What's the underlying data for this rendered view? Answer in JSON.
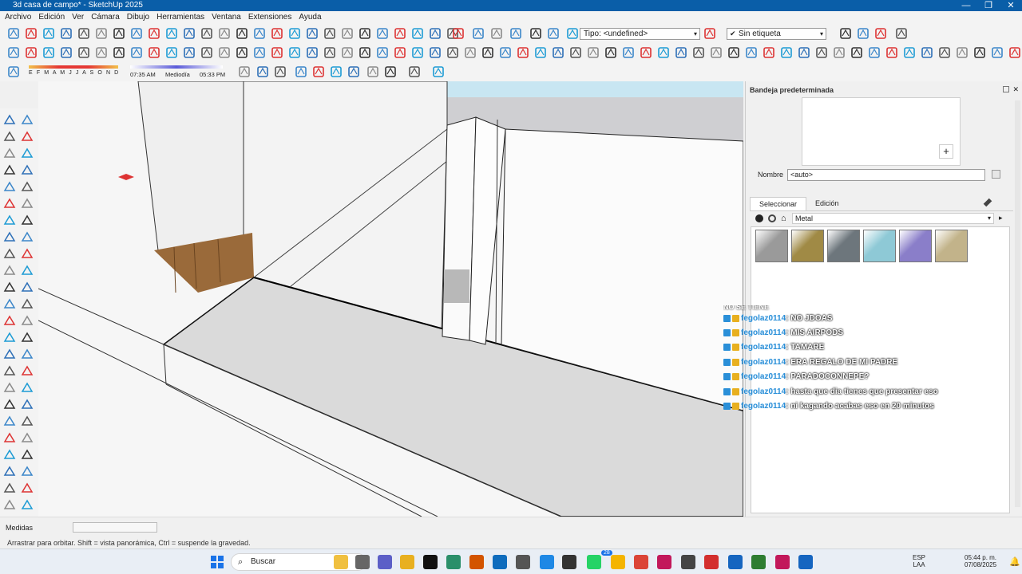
{
  "window": {
    "title": "3d casa de campo* - SketchUp 2025",
    "minimize": "—",
    "maximize": "❐",
    "close": "✕"
  },
  "menu": [
    "Archivo",
    "Edición",
    "Ver",
    "Cámara",
    "Dibujo",
    "Herramientas",
    "Ventana",
    "Extensiones",
    "Ayuda"
  ],
  "toolbar": {
    "tag_type": "Tipo: <undefined>",
    "tag_select": "Sin etiqueta"
  },
  "shadow_bar": {
    "months": "E F M A M J J A S O N D",
    "time_start": "07:35 AM",
    "time_mid": "Mediodía",
    "time_end": "05:33 PM"
  },
  "tray": {
    "title": "Bandeja predeterminada",
    "name_label": "Nombre",
    "name_value": "<auto>",
    "tab_select": "Seleccionar",
    "tab_edit": "Edición",
    "library": "Metal",
    "swatch_colors": [
      "#9a9a9a",
      "#a08a45",
      "#6d767c",
      "#8ec9d6",
      "#8a7ec9",
      "#c2b38a"
    ]
  },
  "chat": {
    "header": "NO SE TIENE",
    "messages": [
      {
        "user": "fegolaz0114",
        "text": ": NO JDOAS"
      },
      {
        "user": "fegolaz0114",
        "text": ": MIS AIRPODS"
      },
      {
        "user": "fegolaz0114",
        "text": ": TAMARE"
      },
      {
        "user": "fegolaz0114",
        "text": ": ERA REGALO DE MI PADRE"
      },
      {
        "user": "fegolaz0114",
        "text": ": PARADOCONNEPE?"
      },
      {
        "user": "fegolaz0114",
        "text": ": hasta que dia tienes que presentar eso"
      },
      {
        "user": "fegolaz0114",
        "text": ": ni kagando acabas eso en 20 minutos"
      }
    ]
  },
  "status": {
    "medidas_label": "Medidas",
    "hint": "Arrastrar para orbitar. Shift = vista panorámica, Ctrl = suspende la gravedad."
  },
  "taskbar": {
    "search_placeholder": "Buscar",
    "lang_top": "ESP",
    "lang_bottom": "LAA",
    "time": "05:44 p. m.",
    "date": "07/08/2025",
    "whatsapp_badge": "28"
  },
  "icons": {
    "toolbar_count": 60,
    "left_tools": 48
  }
}
